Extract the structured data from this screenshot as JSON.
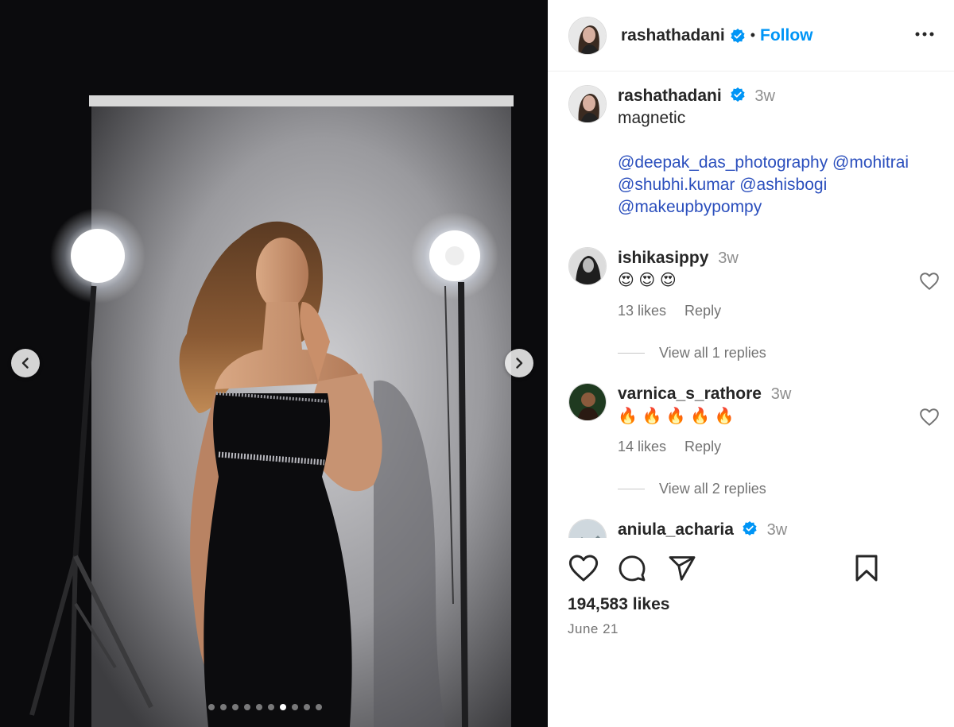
{
  "post": {
    "author": "rashathadani",
    "follow_label": "Follow",
    "separator": "•",
    "likes_text": "194,583 likes",
    "date": "June 21",
    "carousel": {
      "total": 10,
      "active": 7
    }
  },
  "caption": {
    "username": "rashathadani",
    "time": "3w",
    "text": "magnetic",
    "mentions_line1": "@deepak_das_photography @mohitrai",
    "mentions_line2": "@shubhi.kumar @ashisbogi",
    "mentions_line3": "@makeupbypompy"
  },
  "comments": [
    {
      "username": "ishikasippy",
      "time": "3w",
      "text": "😍 😍 😍",
      "likes": "13 likes",
      "reply": "Reply",
      "view_replies": "View all 1 replies"
    },
    {
      "username": "varnica_s_rathore",
      "time": "3w",
      "text": "🔥 🔥 🔥 🔥 🔥",
      "likes": "14 likes",
      "reply": "Reply",
      "view_replies": "View all 2 replies"
    },
    {
      "username": "aniula_acharia",
      "time": "3w"
    }
  ],
  "colors": {
    "link": "#0095f6",
    "verified": "#0095f6",
    "mention": "#2b4fbd"
  },
  "icons": [
    "more-icon",
    "verified-icon",
    "heart-icon",
    "comment-icon",
    "share-icon",
    "bookmark-icon",
    "chevron-left-icon",
    "chevron-right-icon"
  ]
}
